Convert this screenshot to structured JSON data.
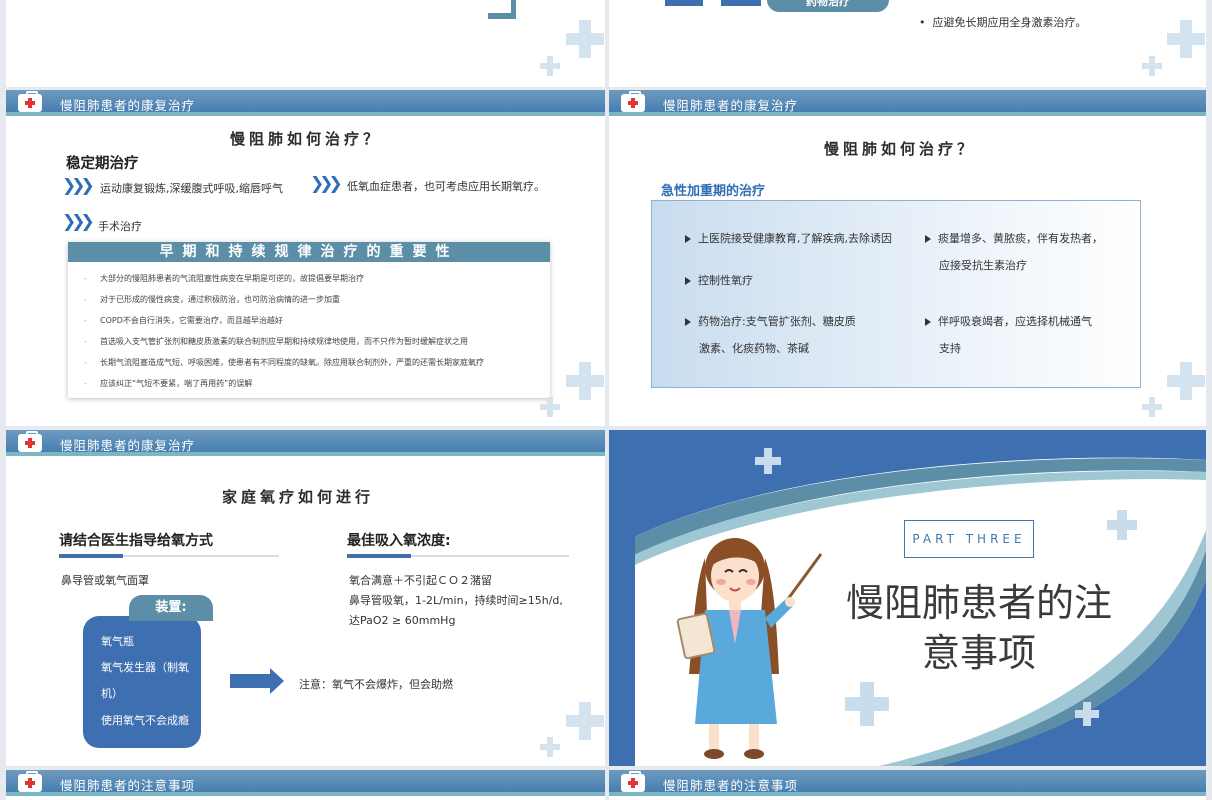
{
  "colors": {
    "accent": "#3f79ad",
    "teal": "#5c8fa7",
    "deco": "#d3e3ef",
    "header_cross": "#e03535"
  },
  "top_left": {},
  "top_right": {
    "pill_label": "药物治疗",
    "bullet": "应避免长期应用全身激素治疗。"
  },
  "slide1": {
    "header": "慢阻肺患者的康复治疗",
    "title": "慢阻肺如何治疗？",
    "subheading": "稳定期治疗",
    "items": [
      "运动康复锻炼,深缓腹式呼吸,缩唇呼气",
      "低氧血症患者，也可考虑应用长期氧疗。",
      "手术治疗"
    ],
    "box_title": "早期和持续规律治疗的重要性",
    "box_items": [
      "大部分的慢阻肺患者的气流阻塞性病变在早期是可逆的，故提倡要早期治疗",
      "对于已形成的慢性病变，通过积极防治，也可防治病情的进一步加重",
      "COPD不会自行消失，它需要治疗，而且越早治越好",
      "首选吸入支气管扩张剂和糖皮质激素的联合制剂应早期和持续规律地使用，而不只作为暂时缓解症状之用",
      "长期气流阻塞造成气短、呼吸困难，使患者有不同程度的缺氧。除应用联合制剂外，严重的还需长期家庭氧疗",
      "应该纠正“气短不要紧，喘了再用药”的误解"
    ]
  },
  "slide2": {
    "header": "慢阻肺患者的康复治疗",
    "title": "慢阻肺如何治疗？",
    "subheading": "急性加重期的治疗",
    "items": [
      {
        "line1": "上医院接受健康教育,了解疾病,去除诱因"
      },
      {
        "line1": "控制性氧疗"
      },
      {
        "line1": "药物治疗:支气管扩张剂、糖皮质",
        "line2": "激素、化痰药物、茶碱"
      },
      {
        "line1": "痰量增多、黄脓痰，伴有发热者，",
        "line2": "应接受抗生素治疗"
      },
      {
        "line1": "伴呼吸衰竭者，应选择机械通气",
        "line2": "支持"
      }
    ]
  },
  "slide3": {
    "header": "慢阻肺患者的康复治疗",
    "title": "家庭氧疗如何进行",
    "left_heading": "请结合医生指导给氧方式",
    "left_text": "鼻导管或氧气面罩",
    "device_label": "装置:",
    "devices": [
      "氧气瓶",
      "氧气发生器（制氧",
      "机）",
      "使用氧气不会成瘾"
    ],
    "note": "注意：氧气不会爆炸，但会助燃",
    "right_heading": "最佳吸入氧浓度:",
    "right_lines": [
      "氧合满意＋不引起ＣＯ２潴留",
      "鼻导管吸氧，1-2L/min，持续时间≥15h/d,",
      "达PaO2 ≥ 60mmHg"
    ]
  },
  "slide4": {
    "part": "PART THREE",
    "title_line1": "慢阻肺患者的注",
    "title_line2": "意事项"
  },
  "bottom": {
    "left_header": "慢阻肺患者的注意事项",
    "right_header": "慢阻肺患者的注意事项"
  },
  "icons": [
    "medkit-icon",
    "plus-icon",
    "chevron-right-icon",
    "arrow-right-icon",
    "triangle-bullet-icon"
  ]
}
